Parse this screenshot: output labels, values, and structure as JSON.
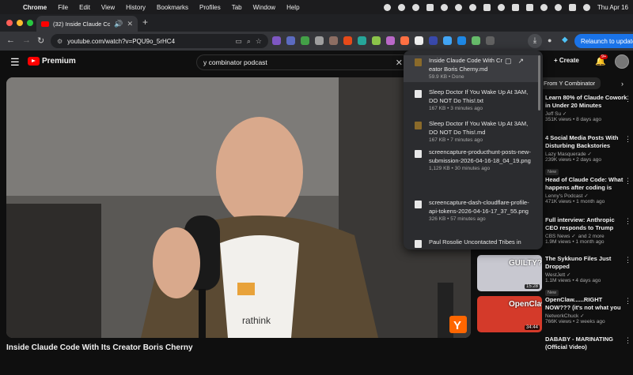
{
  "mac_menu": {
    "app": "Chrome",
    "items": [
      "File",
      "Edit",
      "View",
      "History",
      "Bookmarks",
      "Profiles",
      "Tab",
      "Window",
      "Help"
    ],
    "clock": "Thu Apr 16"
  },
  "tab": {
    "title": "(32) Inside Claude Code W"
  },
  "address": {
    "url": "youtube.com/watch?v=PQU9o_5rHC4"
  },
  "relaunch_label": "Relaunch to update",
  "youtube": {
    "logo_text": "Premium",
    "search_value": "y combinator podcast",
    "create_label": "Create",
    "notif_count": "9+",
    "video_title": "Inside Claude Code With Its Creator Boris Cherny",
    "chips": [
      "From Y Combinator"
    ]
  },
  "downloads": [
    {
      "name": "Inside Claude Code With Creator Boris Cherny.md",
      "meta": "59.9 KB • Done",
      "type": "md"
    },
    {
      "name": "Sleep Doctor If You Wake Up At 3AM, DO NOT Do This!.txt",
      "meta": "167 KB • 3 minutes ago",
      "type": "doc"
    },
    {
      "name": "Sleep Doctor If You Wake Up At 3AM, DO NOT Do This!.md",
      "meta": "167 KB • 7 minutes ago",
      "type": "md"
    },
    {
      "name": "screencapture-producthunt-posts-new-submission-2026-04-16-18_04_19.png",
      "meta": "1,129 KB • 30 minutes ago",
      "type": "doc"
    },
    {
      "name": "screencapture-dash-cloudflare-profile-api-tokens-2026-04-16-17_37_55.png",
      "meta": "326 KB • 57 minutes ago",
      "type": "doc"
    },
    {
      "name": "Paul Rosolie Uncontacted Tribes in",
      "meta": "",
      "type": "doc"
    }
  ],
  "recs": [
    {
      "title": "Learn 80% of Claude Cowork in Under 20 Minutes",
      "channel": "Jeff Su",
      "meta": "351K views • 8 days ago",
      "new": "",
      "dur": ""
    },
    {
      "title": "4 Social Media Posts With Disturbing Backstories",
      "channel": "Lazy Masquerade",
      "meta": "239K views • 2 days ago",
      "new": "New",
      "dur": ""
    },
    {
      "title": "Head of Claude Code: What happens after coding is solved...",
      "channel": "Lenny's Podcast",
      "meta": "471K views • 1 month ago",
      "new": "",
      "dur": ""
    },
    {
      "title": "Full interview: Anthropic CEO responds to Trump order, ...",
      "channel": "CBS News",
      "meta": "1.9M views • 1 month ago",
      "new": "",
      "dur": "",
      "extra": "and 2 more"
    },
    {
      "title": "The Sykkuno Files Just Dropped",
      "channel": "WestJett",
      "meta": "1.1M views • 4 days ago",
      "new": "New",
      "dur": "15:28",
      "thumb_text": "GUILTY?"
    },
    {
      "title": "OpenClaw......RIGHT NOW??? (it's not what you think)",
      "channel": "NetworkChuck",
      "meta": "766K views • 2 weeks ago",
      "new": "",
      "dur": "34:44",
      "thumb_text": "OpenClaw"
    },
    {
      "title": "DABABY - MARINATING (Official Video)",
      "channel": "",
      "meta": "",
      "new": "",
      "dur": ""
    }
  ],
  "video_overlay": {
    "shirt_text": "rathink",
    "corner_logo": "Y"
  },
  "colors": {
    "accent": "#1a73e8",
    "yt_red": "#ff0000",
    "yc_orange": "#ff6600"
  }
}
